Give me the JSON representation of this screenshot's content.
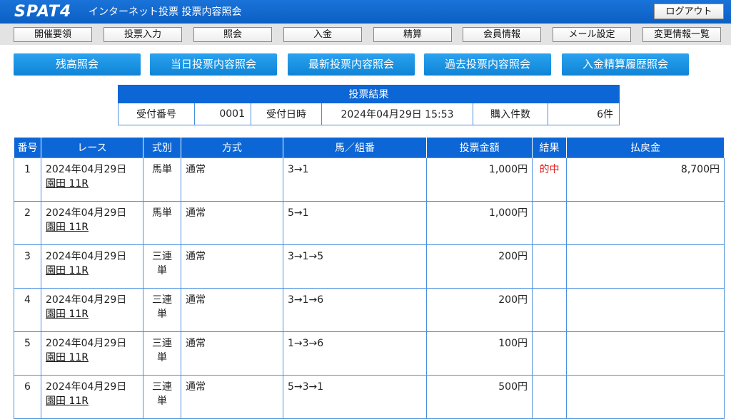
{
  "header": {
    "logo": "SPAT4",
    "subtitle": "インターネット投票 投票内容照会",
    "logout_label": "ログアウト"
  },
  "nav": [
    "開催要領",
    "投票入力",
    "照会",
    "入金",
    "精算",
    "会員情報",
    "メール設定",
    "変更情報一覧"
  ],
  "actions": [
    "残高照会",
    "当日投票内容照会",
    "最新投票内容照会",
    "過去投票内容照会",
    "入金精算履歴照会"
  ],
  "summary": {
    "title": "投票結果",
    "receipt_label": "受付番号",
    "receipt_value": "0001",
    "date_label": "受付日時",
    "date_value": "2024年04月29日 15:53",
    "count_label": "購入件数",
    "count_value": "6件"
  },
  "table": {
    "headers": [
      "番号",
      "レース",
      "式別",
      "方式",
      "馬／組番",
      "投票金額",
      "結果",
      "払戻金"
    ],
    "rows": [
      {
        "no": "1",
        "date": "2024年04月29日",
        "race": "園田 11R",
        "type": "馬単",
        "method": "通常",
        "combo": "3→1",
        "amount": "1,000円",
        "result": "的中",
        "payout": "8,700円"
      },
      {
        "no": "2",
        "date": "2024年04月29日",
        "race": "園田 11R",
        "type": "馬単",
        "method": "通常",
        "combo": "5→1",
        "amount": "1,000円",
        "result": "",
        "payout": ""
      },
      {
        "no": "3",
        "date": "2024年04月29日",
        "race": "園田 11R",
        "type": "三連単",
        "method": "通常",
        "combo": "3→1→5",
        "amount": "200円",
        "result": "",
        "payout": ""
      },
      {
        "no": "4",
        "date": "2024年04月29日",
        "race": "園田 11R",
        "type": "三連単",
        "method": "通常",
        "combo": "3→1→6",
        "amount": "200円",
        "result": "",
        "payout": ""
      },
      {
        "no": "5",
        "date": "2024年04月29日",
        "race": "園田 11R",
        "type": "三連単",
        "method": "通常",
        "combo": "1→3→6",
        "amount": "100円",
        "result": "",
        "payout": ""
      },
      {
        "no": "6",
        "date": "2024年04月29日",
        "race": "園田 11R",
        "type": "三連単",
        "method": "通常",
        "combo": "5→3→1",
        "amount": "500円",
        "result": "",
        "payout": ""
      }
    ]
  },
  "colors": {
    "header": "#0b5fc4",
    "accent": "#0f83d6",
    "hit": "#e02020"
  }
}
